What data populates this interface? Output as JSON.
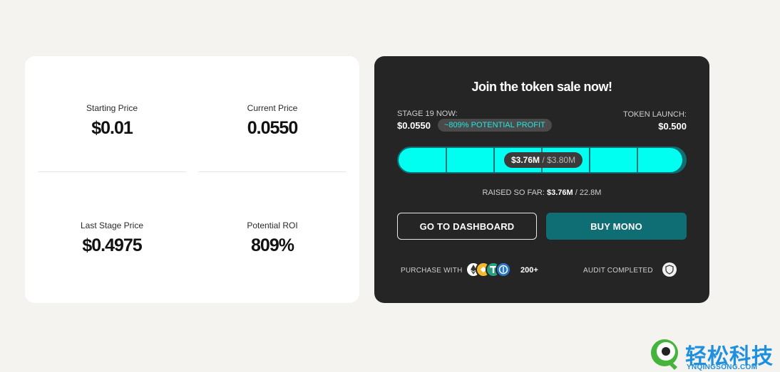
{
  "stats": {
    "starting_price": {
      "label": "Starting Price",
      "value": "$0.01"
    },
    "current_price": {
      "label": "Current Price",
      "value": "0.0550"
    },
    "last_stage_price": {
      "label": "Last Stage Price",
      "value": "$0.4975"
    },
    "potential_roi": {
      "label": "Potential ROI",
      "value": "809%"
    }
  },
  "sale": {
    "title": "Join the token sale now!",
    "stage_label": "STAGE 19 NOW:",
    "stage_price": "$0.0550",
    "profit_badge": "~809% POTENTIAL PROFIT",
    "launch_label": "TOKEN LAUNCH:",
    "launch_price": "$0.500",
    "progress": {
      "raised": "$3.76M",
      "separator": "/",
      "goal": "$3.80M",
      "fraction": 0.989
    },
    "raised_so_far": {
      "label": "RAISED SO FAR:",
      "value": "$3.76M",
      "separator": "/",
      "total": "22.8M"
    },
    "buttons": {
      "dashboard": "GO TO DASHBOARD",
      "buy": "BUY MONO"
    },
    "purchase": {
      "label": "PURCHASE WITH",
      "count": "200+",
      "coins": [
        {
          "icon": "ethereum-icon",
          "color": "#ffffff"
        },
        {
          "icon": "bnb-icon",
          "color": "#f3ba2f"
        },
        {
          "icon": "tether-icon",
          "color": "#26a17b"
        },
        {
          "icon": "usdc-icon",
          "color": "#2775ca"
        }
      ]
    },
    "audit": {
      "label": "AUDIT COMPLETED",
      "icon": "shield-icon"
    }
  },
  "colors": {
    "accent": "#00fff0",
    "brand_teal": "#0f6e74",
    "card_dark": "#252525",
    "page_bg": "#f4f3ef"
  },
  "watermark": {
    "text": "轻松科技",
    "subtext": "YNQINGSONG.COM"
  }
}
